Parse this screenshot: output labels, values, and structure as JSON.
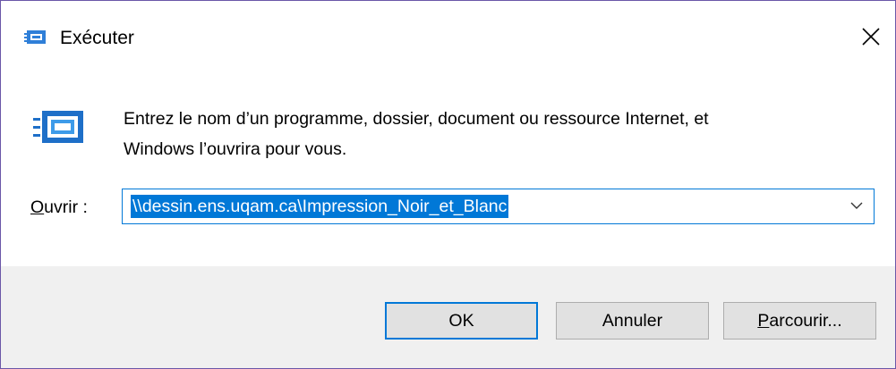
{
  "window": {
    "title": "Exécuter",
    "title_icon": "run-icon",
    "close_icon": "close-icon",
    "accent": "#0078d7",
    "border_color": "#6b57a8"
  },
  "content": {
    "app_icon": "run-icon",
    "description_line1": "Entrez le nom d’un programme, dossier, document ou ressource Internet, et",
    "description_line2": "Windows l’ouvrira pour vous.",
    "open_label_accel": "O",
    "open_label_rest": "uvrir :",
    "open_value": "\\\\dessin.ens.uqam.ca\\Impression_Noir_et_Blanc",
    "dropdown_icon": "chevron-down-icon"
  },
  "buttons": {
    "ok_label": "OK",
    "cancel_label": "Annuler",
    "browse_accel": "P",
    "browse_rest": "arcourir..."
  }
}
